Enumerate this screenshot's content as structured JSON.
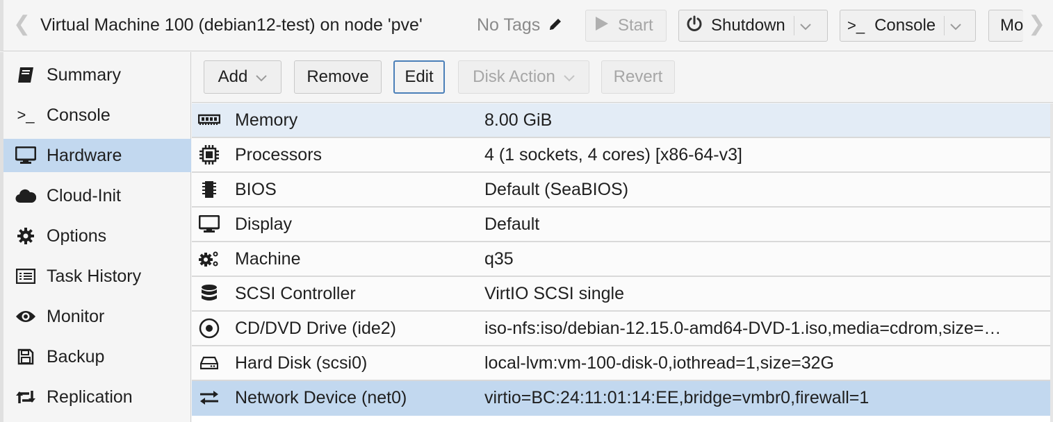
{
  "header": {
    "title": "Virtual Machine 100 (debian12-test) on node 'pve'",
    "tags_label": "No Tags",
    "buttons": {
      "start": "Start",
      "shutdown": "Shutdown",
      "console": "Console",
      "more": "More"
    }
  },
  "sidebar": {
    "items": [
      {
        "label": "Summary",
        "icon": "book-icon"
      },
      {
        "label": "Console",
        "icon": "terminal-icon"
      },
      {
        "label": "Hardware",
        "icon": "desktop-icon",
        "active": true
      },
      {
        "label": "Cloud-Init",
        "icon": "cloud-icon"
      },
      {
        "label": "Options",
        "icon": "gear-icon"
      },
      {
        "label": "Task History",
        "icon": "list-icon"
      },
      {
        "label": "Monitor",
        "icon": "eye-icon"
      },
      {
        "label": "Backup",
        "icon": "floppy-icon"
      },
      {
        "label": "Replication",
        "icon": "retweet-icon"
      }
    ]
  },
  "toolbar": {
    "add": "Add",
    "remove": "Remove",
    "edit": "Edit",
    "disk_action": "Disk Action",
    "revert": "Revert"
  },
  "hardware": [
    {
      "key": "Memory",
      "value": "8.00 GiB",
      "icon": "memory-icon"
    },
    {
      "key": "Processors",
      "value": "4 (1 sockets, 4 cores) [x86-64-v3]",
      "icon": "cpu-icon"
    },
    {
      "key": "BIOS",
      "value": "Default (SeaBIOS)",
      "icon": "chip-icon"
    },
    {
      "key": "Display",
      "value": "Default",
      "icon": "monitor-icon"
    },
    {
      "key": "Machine",
      "value": "q35",
      "icon": "cogs-icon"
    },
    {
      "key": "SCSI Controller",
      "value": "VirtIO SCSI single",
      "icon": "database-icon"
    },
    {
      "key": "CD/DVD Drive (ide2)",
      "value": "iso-nfs:iso/debian-12.15.0-amd64-DVD-1.iso,media=cdrom,size=…",
      "icon": "disc-icon"
    },
    {
      "key": "Hard Disk (scsi0)",
      "value": "local-lvm:vm-100-disk-0,iothread=1,size=32G",
      "icon": "hdd-icon"
    },
    {
      "key": "Network Device (net0)",
      "value": "virtio=BC:24:11:01:14:EE,bridge=vmbr0,firewall=1",
      "icon": "exchange-icon"
    }
  ],
  "colors": {
    "selected": "#c2d8ef",
    "hover": "#e3ecf6",
    "focus_border": "#4a7fb8"
  }
}
